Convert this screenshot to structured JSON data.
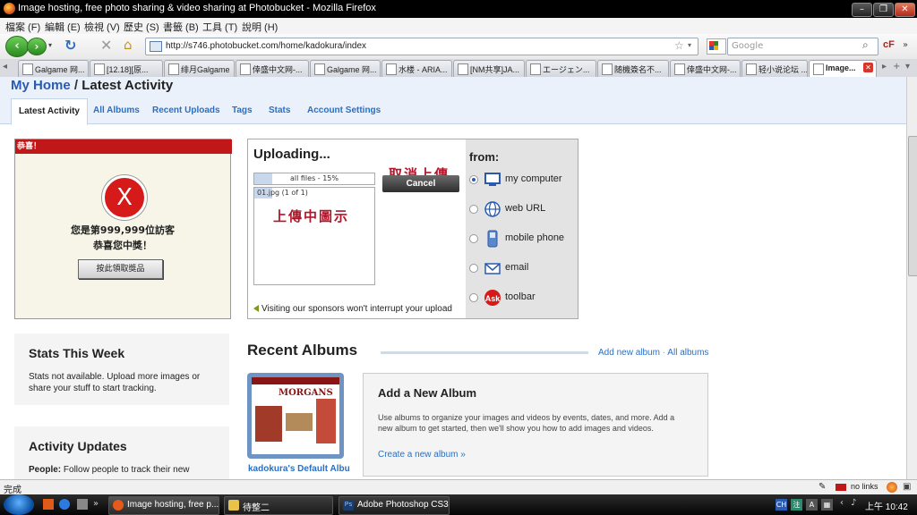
{
  "window": {
    "title": "Image hosting, free photo sharing & video sharing at Photobucket - Mozilla Firefox"
  },
  "menu": [
    "檔案 (F)",
    "編輯 (E)",
    "檢視 (V)",
    "歷史 (S)",
    "書籤 (B)",
    "工具 (T)",
    "說明 (H)"
  ],
  "nav": {
    "url": "http://s746.photobucket.com/home/kadokura/index",
    "search_placeholder": "Google"
  },
  "tabs": [
    "Galgame 网...",
    "[12.18][原...",
    "绯月Galgame",
    "倖盛中文网-...",
    "Galgame 网...",
    "水楼 - ARIA...",
    "[NM共享]JA...",
    "エージェン...",
    "随機簽名不...",
    "倖盛中文网-...",
    "轻小说论坛 ...",
    "Image..."
  ],
  "page": {
    "home_link": "My Home",
    "separator": "/",
    "section": "Latest Activity",
    "tabs": [
      "Latest Activity",
      "All Albums",
      "Recent Uploads",
      "Tags",
      "Stats",
      "Account Settings"
    ],
    "ad": {
      "header": "恭喜！",
      "x_symbol": "X",
      "line1": "您是第999,999位訪客",
      "line2": "恭喜您中獎！",
      "button": "按此領取獎品"
    },
    "upload": {
      "title": "Uploading...",
      "all_files": "all files - 15%",
      "all_progress": 0.15,
      "file": "01.jpg (1 of 1)",
      "file_progress": 0.15,
      "cancel": "Cancel",
      "note_cancel": "取消上傳",
      "note_icon": "上傳中圖示",
      "sponsor": "Visiting our sponsors won't interrupt your upload",
      "from": "from:",
      "sources": [
        {
          "label": "my computer",
          "icon": "computer-icon",
          "selected": true
        },
        {
          "label": "web URL",
          "icon": "globe-icon",
          "selected": false
        },
        {
          "label": "mobile phone",
          "icon": "mobile-phone-icon",
          "selected": false
        },
        {
          "label": "email",
          "icon": "email-icon",
          "selected": false
        },
        {
          "label": "toolbar",
          "icon": "ask-icon",
          "selected": false
        }
      ]
    },
    "stats": {
      "title": "Stats This Week",
      "text": "Stats not available. Upload more images or share your stuff to start tracking."
    },
    "activity": {
      "title": "Activity Updates",
      "people_label": "People:",
      "people_text": "Follow people to track their new"
    },
    "recent_albums": {
      "title": "Recent Albums",
      "add_link": "Add new album",
      "dot": "·",
      "all_link": "All albums",
      "album_caption": "kadokura's Default Albu",
      "thumb_logo": "MORGANS",
      "new_album_title": "Add a New Album",
      "new_album_text": "Use albums to organize your images and videos by events, dates, and more. Add a new album to get started, then we'll show you how to add images and videos.",
      "new_album_link": "Create a new album »"
    }
  },
  "statusbar": {
    "text": "完成",
    "no_links": "no links"
  },
  "taskbar": {
    "items": [
      "Image hosting, free p...",
      "待整二",
      "Adobe Photoshop CS3..."
    ],
    "clock": "上午 10:42"
  },
  "colors": {
    "link": "#2a6fc4",
    "ad_red": "#c01818",
    "note_red": "#b1152a"
  }
}
